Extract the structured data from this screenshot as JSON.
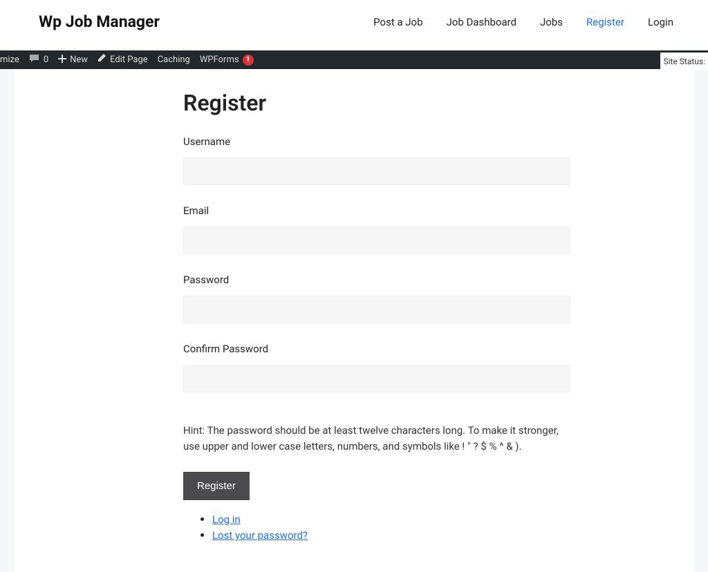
{
  "header": {
    "site_title": "Wp Job Manager",
    "nav": {
      "post_job": "Post a Job",
      "job_dashboard": "Job Dashboard",
      "jobs": "Jobs",
      "register": "Register",
      "login": "Login"
    }
  },
  "admin_bar": {
    "customize_fragment": "mize",
    "comments_count": "0",
    "new_label": "New",
    "edit_page": "Edit Page",
    "caching": "Caching",
    "wpforms": "WPForms",
    "wpforms_badge": "1",
    "site_status": "Site Status:"
  },
  "page": {
    "title": "Register",
    "labels": {
      "username": "Username",
      "email": "Email",
      "password": "Password",
      "confirm_password": "Confirm Password"
    },
    "hint": "Hint: The password should be at least twelve characters long. To make it stronger, use upper and lower case letters, numbers, and symbols like ! \" ? $ % ^ & ).",
    "submit": "Register",
    "links": {
      "login": "Log in",
      "lost_password": "Lost your password?"
    }
  }
}
